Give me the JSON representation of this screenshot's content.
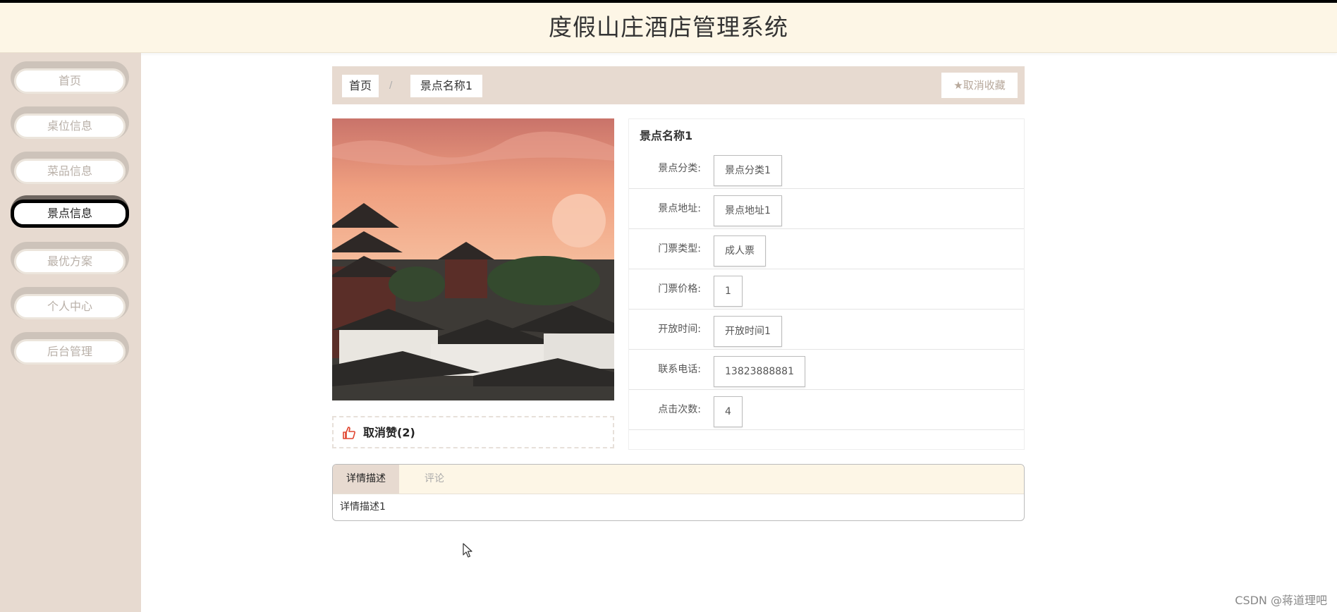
{
  "header": {
    "title": "度假山庄酒店管理系统"
  },
  "sidebar": {
    "items": [
      {
        "label": "首页",
        "active": false
      },
      {
        "label": "桌位信息",
        "active": false
      },
      {
        "label": "菜品信息",
        "active": false
      },
      {
        "label": "景点信息",
        "active": true
      },
      {
        "label": "最优方案",
        "active": false
      },
      {
        "label": "个人中心",
        "active": false
      },
      {
        "label": "后台管理",
        "active": false
      }
    ]
  },
  "breadcrumb": {
    "home": "首页",
    "separator": "/",
    "current": "景点名称1",
    "favorite_label": "取消收藏"
  },
  "like": {
    "label": "取消赞(2)"
  },
  "detail": {
    "name": "景点名称1",
    "fields": [
      {
        "label": "景点分类:",
        "value": "景点分类1"
      },
      {
        "label": "景点地址:",
        "value": "景点地址1"
      },
      {
        "label": "门票类型:",
        "value": "成人票"
      },
      {
        "label": "门票价格:",
        "value": "1"
      },
      {
        "label": "开放时间:",
        "value": "开放时间1"
      },
      {
        "label": "联系电话:",
        "value": "13823888881"
      },
      {
        "label": "点击次数:",
        "value": "4"
      }
    ]
  },
  "tabs": {
    "items": [
      {
        "label": "详情描述",
        "active": true
      },
      {
        "label": "评论",
        "active": false
      }
    ],
    "content": "详情描述1"
  },
  "watermark": "CSDN @蒋道理吧"
}
